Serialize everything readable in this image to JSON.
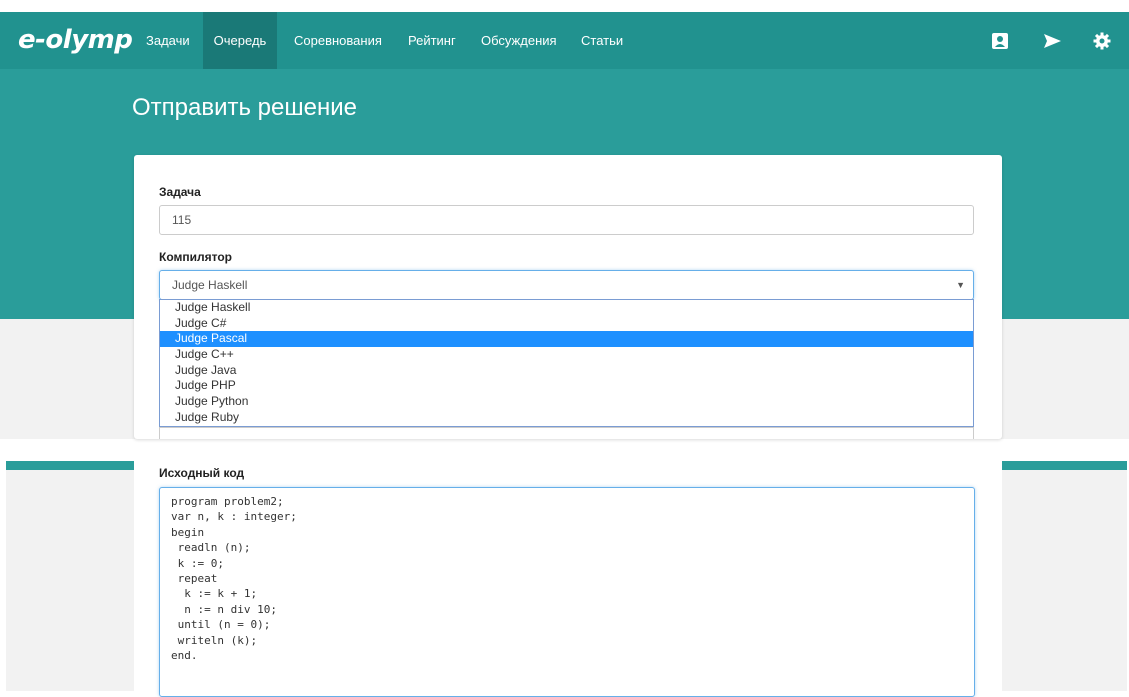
{
  "brand": "e-olymp",
  "nav": {
    "items": [
      {
        "label": "Задачи"
      },
      {
        "label": "Очередь"
      },
      {
        "label": "Соревнования"
      },
      {
        "label": "Рейтинг"
      },
      {
        "label": "Обсуждения"
      },
      {
        "label": "Статьи"
      }
    ],
    "active_index": 1,
    "icons": [
      "profile-icon",
      "send-icon",
      "gear-icon"
    ]
  },
  "page_title": "Отправить решение",
  "form": {
    "problem_label": "Задача",
    "problem_value": "115",
    "compiler_label": "Компилятор",
    "compiler_value": "Judge Haskell",
    "compiler_options": [
      "Judge Haskell",
      "Judge C#",
      "Judge Pascal",
      "Judge C++",
      "Judge Java",
      "Judge PHP",
      "Judge Python",
      "Judge Ruby"
    ],
    "highlighted_option": "Judge Pascal",
    "source_label": "Исходный код",
    "source_code": "program problem2;\nvar n, k : integer;\nbegin\n readln (n);\n k := 0;\n repeat\n  k := k + 1;\n  n := n div 10;\n until (n = 0);\n writeln (k);\nend."
  },
  "colors": {
    "navbar": "#21928f",
    "nav_active": "#1a7977",
    "hero": "#2a9d9a",
    "highlight": "#1e90ff",
    "focus_border": "#66afe9"
  }
}
